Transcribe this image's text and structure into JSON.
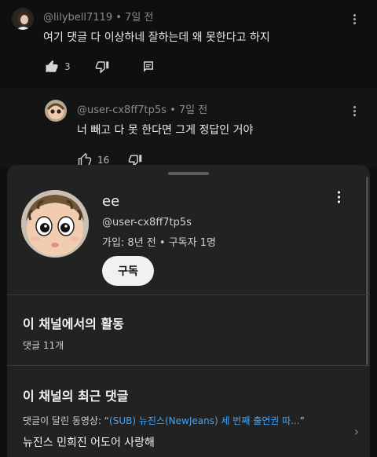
{
  "comment1": {
    "handle": "@lilybell7119",
    "age": "7일 전",
    "text": "여기 댓글 다 이상하네 잘하는데 왜 못한다고 하지",
    "likes": "3"
  },
  "comment2": {
    "handle": "@user-cx8ff7tp5s",
    "age": "7일 전",
    "text": "너 빼고 다 못 한다면 그게 정답인 거야",
    "likes": "16"
  },
  "channel_sheet": {
    "name": "ee",
    "handle": "@user-cx8ff7tp5s",
    "stats": "가입: 8년 전 • 구독자 1명",
    "subscribe_label": "구독",
    "activity_title": "이 채널에서의 활동",
    "activity_sub": "댓글 11개",
    "recent_title": "이 채널의 최근 댓글",
    "video_prefix": "댓글이 달린 동영상: “",
    "video_title": "(SUB) 뉴진스(NewJeans) 세 번째 출연권 따...",
    "video_suffix": "”",
    "recent_comment": "뉴진스 민희진 어도어 사랑해"
  },
  "icons": [
    "like-icon",
    "dislike-icon",
    "reply-icon",
    "more-vert-icon",
    "chevron-right-icon"
  ]
}
